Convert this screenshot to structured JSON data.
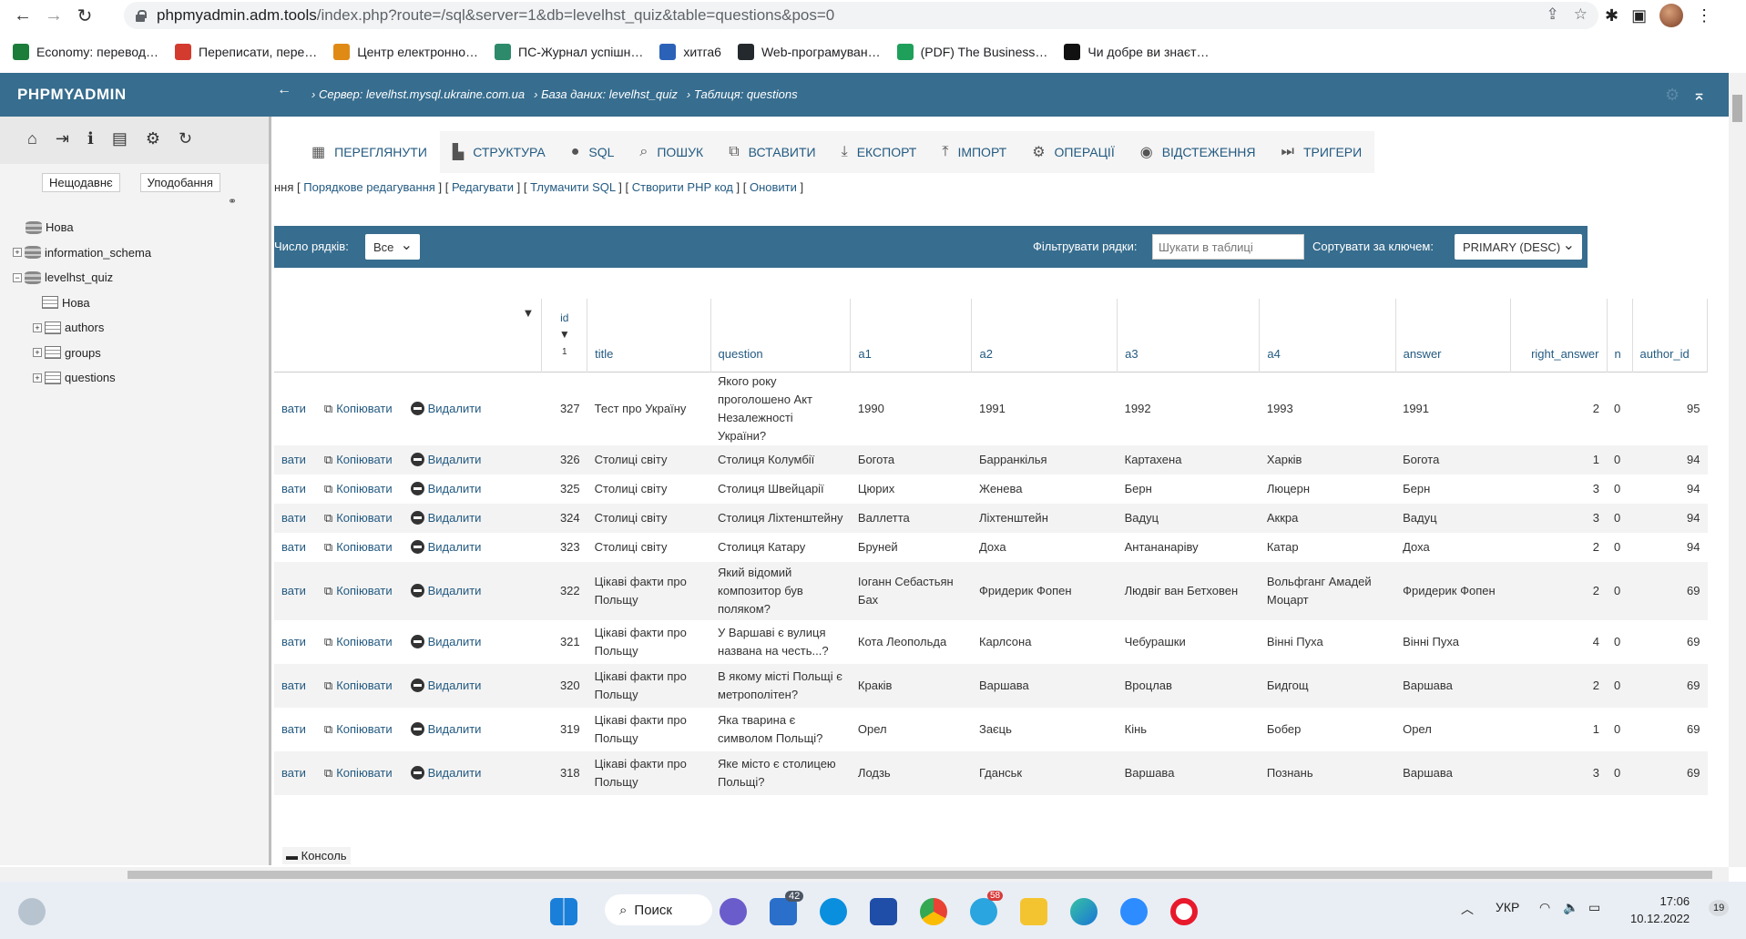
{
  "browser": {
    "url_host": "phpmyadmin.adm.tools",
    "url_path": "/index.php?route=/sql&server=1&db=levelhst_quiz&table=questions&pos=0",
    "bookmarks": [
      "Economy: перевод…",
      "Переписати, пере…",
      "Центр електронно…",
      "ПС-Журнал успішн…",
      "хитга6",
      "Web-програмуван…",
      "(PDF) The Business…",
      "Чи добре ви знаєт…"
    ]
  },
  "pma": {
    "logo": "PHPMYADMIN",
    "breadcrumb": [
      "Сервер: levelhst.mysql.ukraine.com.ua",
      "База даних: levelhst_quiz",
      "Таблиця: questions"
    ],
    "sidebar": {
      "tabs": [
        "Нещодавнє",
        "Уподобання"
      ],
      "tree": [
        {
          "label": "Нова",
          "level": 0
        },
        {
          "label": "information_schema",
          "level": 0
        },
        {
          "label": "levelhst_quiz",
          "level": 0
        },
        {
          "label": "Нова",
          "level": 1
        },
        {
          "label": "authors",
          "level": 1
        },
        {
          "label": "groups",
          "level": 1
        },
        {
          "label": "questions",
          "level": 1
        }
      ]
    },
    "tabs": [
      "ПЕРЕГЛЯНУТИ",
      "СТРУКТУРА",
      "SQL",
      "ПОШУК",
      "ВСТАВИТИ",
      "ЕКСПОРТ",
      "ІМПОРТ",
      "ОПЕРАЦІЇ",
      "ВІДСТЕЖЕННЯ",
      "ТРИГЕРИ"
    ],
    "actions": {
      "prefix": "ння",
      "links": [
        "Порядкове редагування",
        "Редагувати",
        "Тлумачити SQL",
        "Створити PHP код",
        "Оновити"
      ]
    },
    "filter": {
      "rows_label": "Число рядків:",
      "rows_value": "Все",
      "filter_label": "Фільтрувати рядки:",
      "search_placeholder": "Шукати в таблиці",
      "sort_label": "Сортувати за ключем:",
      "sort_value": "PRIMARY (DESC)"
    },
    "columns": [
      "id",
      "title",
      "question",
      "a1",
      "a2",
      "a3",
      "a4",
      "answer",
      "right_answer",
      "n",
      "author_id"
    ],
    "id_sort_num": "1",
    "row_actions": {
      "edit": "вати",
      "copy": "Копіювати",
      "delete": "Видалити"
    },
    "rows": [
      {
        "id": "327",
        "title": "Тест про Україну",
        "question": "Якого року проголошено Акт Незалежності України?",
        "a1": "1990",
        "a2": "1991",
        "a3": "1992",
        "a4": "1993",
        "answer": "1991",
        "right_answer": "2",
        "n": "0",
        "author_id": "95"
      },
      {
        "id": "326",
        "title": "Столиці світу",
        "question": "Столиця Колумбії",
        "a1": "Богота",
        "a2": "Барранкілья",
        "a3": "Картахена",
        "a4": "Харків",
        "answer": "Богота",
        "right_answer": "1",
        "n": "0",
        "author_id": "94"
      },
      {
        "id": "325",
        "title": "Столиці світу",
        "question": "Столиця Швейцарії",
        "a1": "Цюрих",
        "a2": "Женева",
        "a3": "Берн",
        "a4": "Люцерн",
        "answer": "Берн",
        "right_answer": "3",
        "n": "0",
        "author_id": "94"
      },
      {
        "id": "324",
        "title": "Столиці світу",
        "question": "Столиця Ліхтенштейну",
        "a1": "Валлетта",
        "a2": "Ліхтенштейн",
        "a3": "Вадуц",
        "a4": "Аккра",
        "answer": "Вадуц",
        "right_answer": "3",
        "n": "0",
        "author_id": "94"
      },
      {
        "id": "323",
        "title": "Столиці світу",
        "question": "Столиця Катару",
        "a1": "Бруней",
        "a2": "Доха",
        "a3": "Антананаріву",
        "a4": "Катар",
        "answer": "Доха",
        "right_answer": "2",
        "n": "0",
        "author_id": "94"
      },
      {
        "id": "322",
        "title": "Цікаві факти про Польщу",
        "question": "Який відомий композитор був поляком?",
        "a1": "Іоганн Себастьян Бах",
        "a2": "Фридерик Фопен",
        "a3": "Людвіг ван Бетховен",
        "a4": "Вольфганг Амадей Моцарт",
        "answer": "Фридерик Фопен",
        "right_answer": "2",
        "n": "0",
        "author_id": "69"
      },
      {
        "id": "321",
        "title": "Цікаві факти про Польщу",
        "question": "У Варшаві є вулиця названа на честь...?",
        "a1": "Кота Леопольда",
        "a2": "Карлсона",
        "a3": "Чебурашки",
        "a4": "Вінні Пуха",
        "answer": "Вінні Пуха",
        "right_answer": "4",
        "n": "0",
        "author_id": "69"
      },
      {
        "id": "320",
        "title": "Цікаві факти про Польщу",
        "question": "В якому місті Польщі є метрополітен?",
        "a1": "Краків",
        "a2": "Варшава",
        "a3": "Вроцлав",
        "a4": "Бидгощ",
        "answer": "Варшава",
        "right_answer": "2",
        "n": "0",
        "author_id": "69"
      },
      {
        "id": "319",
        "title": "Цікаві факти про Польщу",
        "question": "Яка тварина є символом Польщі?",
        "a1": "Орел",
        "a2": "Заєць",
        "a3": "Кінь",
        "a4": "Бобер",
        "answer": "Орел",
        "right_answer": "1",
        "n": "0",
        "author_id": "69"
      },
      {
        "id": "318",
        "title": "Цікаві факти про Польщу",
        "question": "Яке місто є столицею Польщі?",
        "a1": "Лодзь",
        "a2": "Гданськ",
        "a3": "Варшава",
        "a4": "Познань",
        "answer": "Варшава",
        "right_answer": "3",
        "n": "0",
        "author_id": "69"
      }
    ],
    "console_label": "Консоль"
  },
  "taskbar": {
    "search_label": "Поиск",
    "mail_badge": "42",
    "telegram_badge": "58",
    "lang": "УКР",
    "time": "17:06",
    "date": "10.12.2022",
    "notif_count": "19"
  },
  "colors": {
    "pma_blue": "#376d8e",
    "link": "#235a81"
  }
}
